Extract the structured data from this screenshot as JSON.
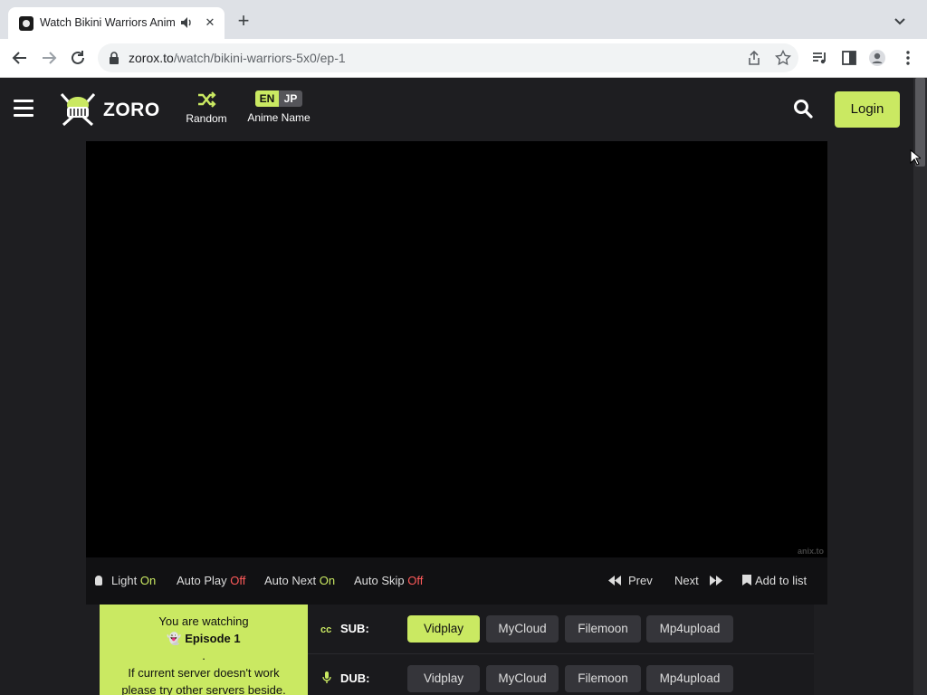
{
  "browser": {
    "tab_title": "Watch Bikini Warriors Anim",
    "url_host": "zorox.to",
    "url_path": "/watch/bikini-warriors-5x0/ep-1"
  },
  "header": {
    "logo": "ZORO",
    "random_label": "Random",
    "lang_en": "EN",
    "lang_jp": "JP",
    "anime_name_label": "Anime Name",
    "login_label": "Login"
  },
  "player": {
    "watermark": "anix.to"
  },
  "controls": {
    "light": "Light",
    "light_state": "On",
    "autoplay": "Auto Play",
    "autoplay_state": "Off",
    "autonext": "Auto Next",
    "autonext_state": "On",
    "autoskip": "Auto Skip",
    "autoskip_state": "Off",
    "prev": "Prev",
    "next": "Next",
    "add_to_list": "Add to list"
  },
  "watching": {
    "line1": "You are watching",
    "episode": "Episode 1",
    "dot": ".",
    "line3": "If current server doesn't work",
    "line4": "please try other servers beside."
  },
  "servers": {
    "sub_label": "SUB:",
    "dub_label": "DUB:",
    "sub": [
      "Vidplay",
      "MyCloud",
      "Filemoon",
      "Mp4upload"
    ],
    "dub": [
      "Vidplay",
      "MyCloud",
      "Filemoon",
      "Mp4upload"
    ],
    "active": "sub-Vidplay"
  },
  "colors": {
    "accent": "#cae962",
    "background": "#1e1e21",
    "off": "#ff5a5a"
  }
}
